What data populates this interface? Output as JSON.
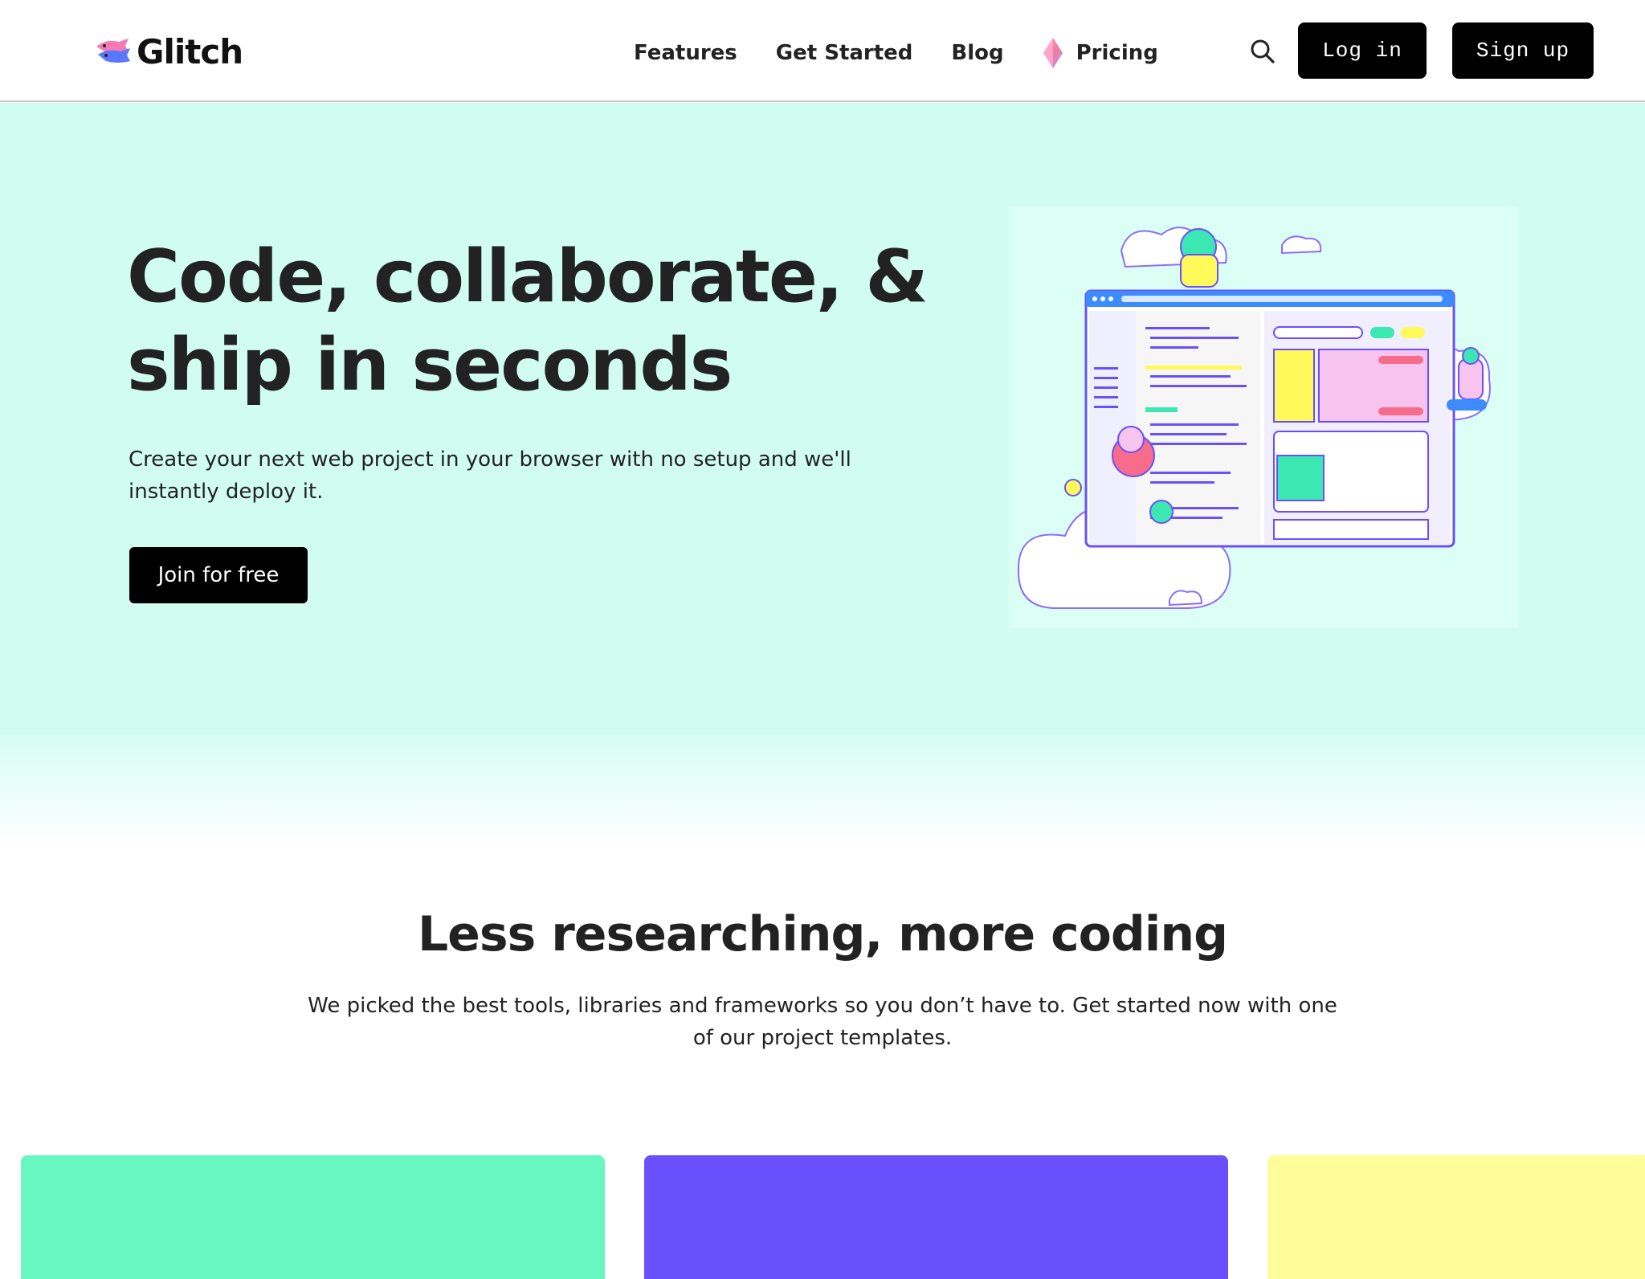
{
  "header": {
    "brand": "Glitch",
    "logo_icon": "glitch-fish-logo",
    "nav": [
      {
        "label": "Features"
      },
      {
        "label": "Get Started"
      },
      {
        "label": "Blog"
      },
      {
        "label": "Pricing",
        "icon": "gem-icon"
      }
    ],
    "search_icon": "search-icon",
    "login_label": "Log in",
    "signup_label": "Sign up"
  },
  "hero": {
    "title_line1": "Code, collaborate, &",
    "title_line2": "ship in seconds",
    "subtitle": "Create your next web project in your browser with no setup and we'll instantly deploy it.",
    "cta_label": "Join for free",
    "background": "#d0fdef"
  },
  "templates_section": {
    "title": "Less researching, more coding",
    "subtitle": "We picked the best tools, libraries and frameworks so you don’t have to. Get started now with one of our project templates.",
    "card_colors": [
      "#69f7c1",
      "#6a50fd",
      "#fffc9a"
    ]
  },
  "colors": {
    "button_bg": "#000000",
    "text": "#222222",
    "accent_purple": "#6a50fd",
    "accent_green": "#69f7c1",
    "accent_yellow": "#fffc9a"
  }
}
